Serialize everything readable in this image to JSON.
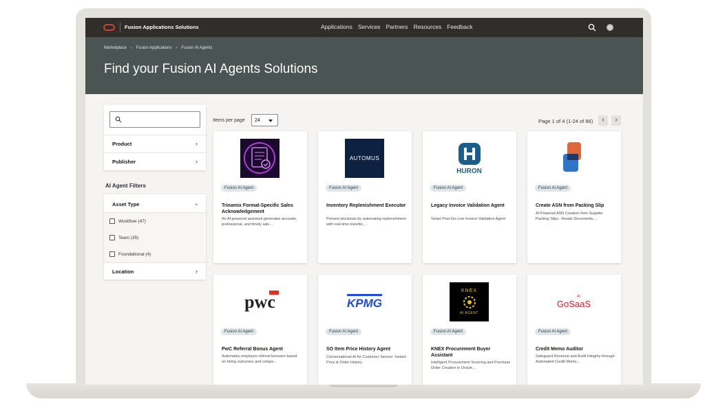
{
  "header": {
    "site_title": "Fusion Applications Solutions",
    "nav": [
      "Applications",
      "Services",
      "Partners",
      "Resources",
      "Feedback"
    ]
  },
  "breadcrumb": [
    "Marketplace",
    "Fusion Applications",
    "Fusion AI Agents"
  ],
  "hero_title": "Find your Fusion AI Agents Solutions",
  "sidebar": {
    "search_placeholder": "",
    "product_label": "Product",
    "publisher_label": "Publisher",
    "filters_heading": "AI Agent Filters",
    "asset_type_label": "Asset Type",
    "asset_types": [
      "Workflow (47)",
      "Team (35)",
      "Foundational (4)"
    ],
    "location_label": "Location"
  },
  "listing": {
    "items_per_page_label": "Items per page",
    "items_per_page_value": "24",
    "page_info": "Page 1 of 4 (1-24 of 86)"
  },
  "cards": [
    {
      "badge": "Fusion AI Agent",
      "title": "Trinamix Format-Specific Sales Acknowledgement",
      "desc": "An AI-powered assistant generates accurate, professional, and timely sale…",
      "logo": "trinamix-logo"
    },
    {
      "badge": "Fusion AI Agent",
      "title": "Inventory Replenishment Executor",
      "desc": "Prevent stockouts by automating replenishment with real-time transfer,…",
      "logo": "automus-logo",
      "logo_text": "AUTOMUS"
    },
    {
      "badge": "Fusion AI Agent",
      "title": "Legacy Invoice Validation Agent",
      "desc": "Smart Post-Go-Live Invoice Validation Agent",
      "logo": "huron-logo",
      "logo_text": "HURON"
    },
    {
      "badge": "Fusion AI Agent",
      "title": "Create ASN from Packing Slip",
      "desc": "AI-Powered ASN Creation from Supplier Packing Slips - Reads Documents,…",
      "logo": "asn-logo"
    },
    {
      "badge": "Fusion AI Agent",
      "title": "PwC Referral Bonus Agent",
      "desc": "Automates employee referral bonuses based on hiring outcomes and compa…",
      "logo": "pwc-logo",
      "logo_text": "pwc"
    },
    {
      "badge": "Fusion AI Agent",
      "title": "SO Item Price History Agent",
      "desc": "Conversational AI for Customer Service: Instant Price & Order History",
      "logo": "kpmg-logo",
      "logo_text": "KPMG"
    },
    {
      "badge": "Fusion AI Agent",
      "title": "KNEX Procurement Buyer Assistant",
      "desc": "Intelligent Procurement Sourcing and Purchase Order Creation in Oracle…",
      "logo": "knex-logo",
      "logo_text": "KNEX",
      "logo_sub": "AI AGENT"
    },
    {
      "badge": "Fusion AI Agent",
      "title": "Credit Memo Auditor",
      "desc": "Safeguard Revenue and Audit Integrity through Automated Credit Memo…",
      "logo": "gosaas-logo",
      "logo_text": "GoSaaS",
      "logo_sup": "AI"
    }
  ],
  "colors": {
    "header": "#312d2a",
    "hero": "#4a5553",
    "brand_red": "#c74634",
    "badge_bg": "#dfe6ea"
  }
}
